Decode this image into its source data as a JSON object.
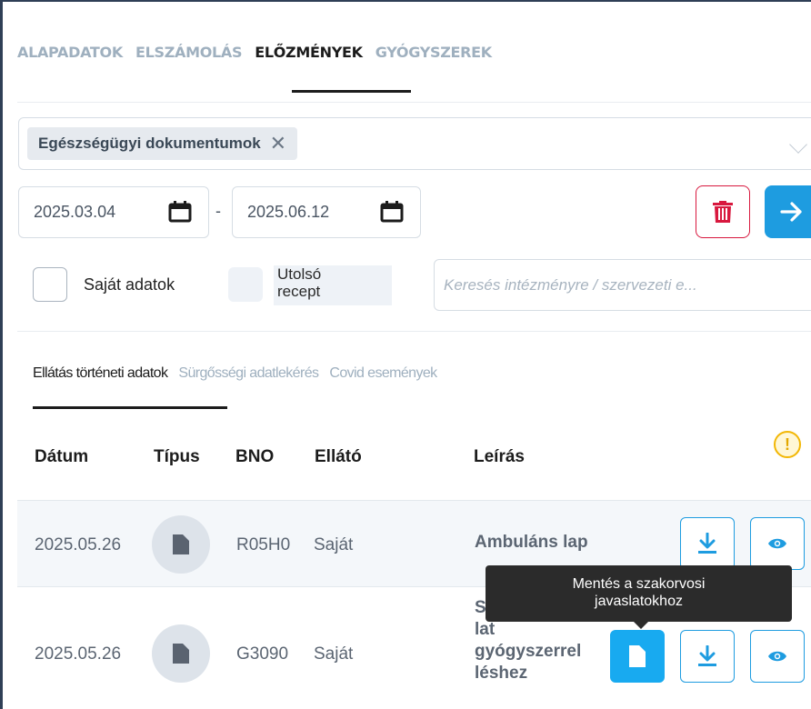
{
  "top_tabs": [
    {
      "label": "ALAPADATOK",
      "active": false
    },
    {
      "label": "ELSZÁMOLÁS",
      "active": false
    },
    {
      "label": "ELŐZMÉNYEK",
      "active": true
    },
    {
      "label": "GYÓGYSZEREK",
      "active": false
    }
  ],
  "filter": {
    "selected_chip": "Egészségügyi dokumentumok",
    "chip_remove_glyph": "✕"
  },
  "dates": {
    "from": "2025.03.04",
    "separator": "-",
    "to": "2025.06.12"
  },
  "options": {
    "own_data_label": "Saját adatok",
    "last_recipe_label_line1": "Utolsó",
    "last_recipe_label_line2": "recept",
    "search_placeholder": "Keresés intézményre / szervezeti e..."
  },
  "sub_tabs": [
    {
      "label": "Ellátás történeti adatok",
      "active": true
    },
    {
      "label": "Sürgősségi adatlekérés",
      "active": false
    },
    {
      "label": "Covid események",
      "active": false
    }
  ],
  "table": {
    "headers": {
      "date": "Dátum",
      "type": "Típus",
      "bno": "BNO",
      "provider": "Ellátó",
      "description": "Leírás"
    },
    "warning_glyph": "!",
    "rows": [
      {
        "date": "2025.05.26",
        "bno": "R05H0",
        "provider": "Saját",
        "description": "Ambuláns lap"
      },
      {
        "date": "2025.05.26",
        "bno": "G3090",
        "provider": "Saját",
        "description_lines": [
          "S",
          "lat",
          "gyógyszerrel",
          "léshez"
        ]
      }
    ]
  },
  "tooltip": {
    "line1": "Mentés a szakorvosi",
    "line2": "javaslatokhoz"
  },
  "colors": {
    "accent": "#1e9ce0",
    "danger": "#d8183e",
    "warning": "#f2b705"
  }
}
